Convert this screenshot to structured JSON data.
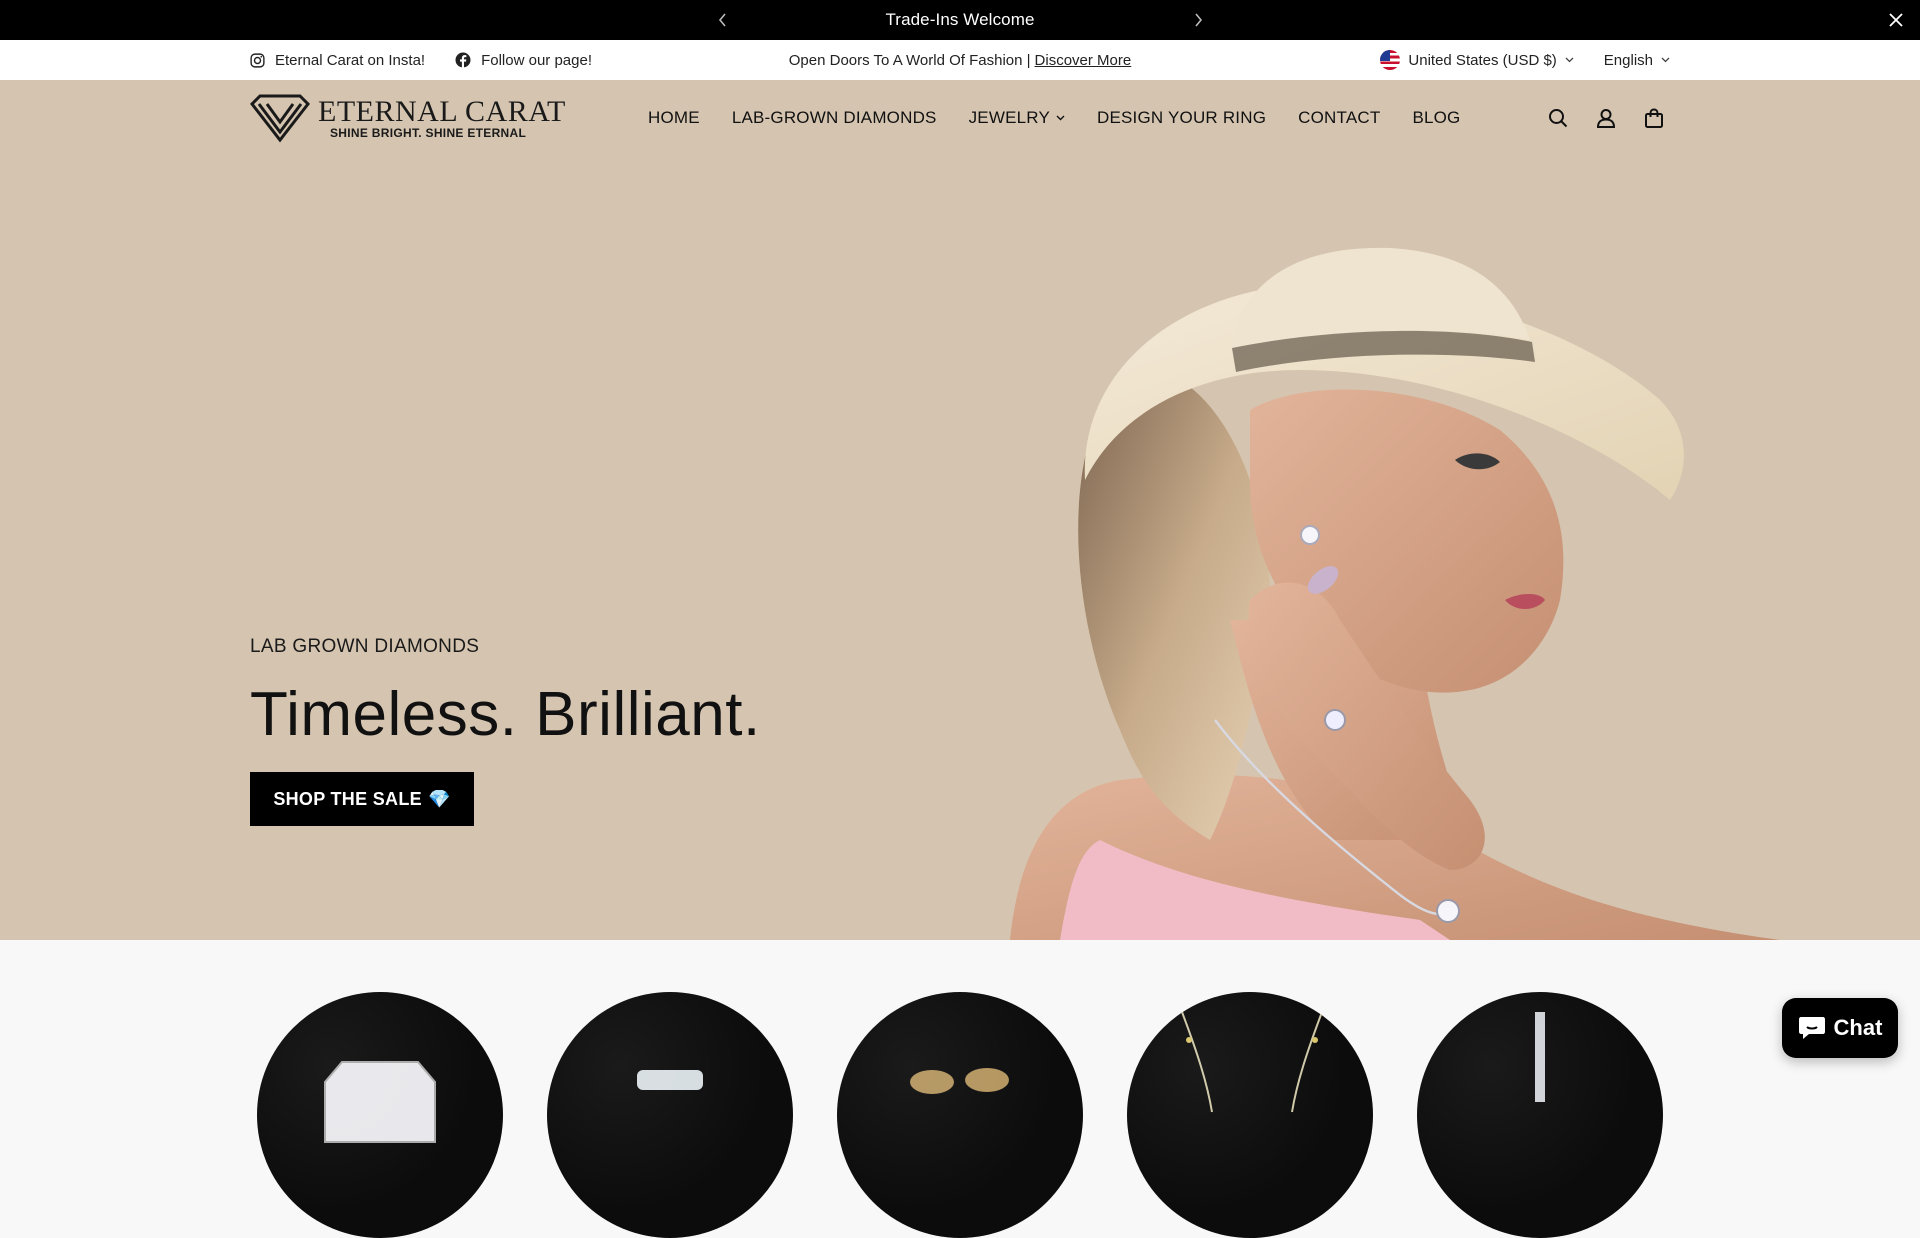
{
  "announcement": {
    "text": "Trade-Ins Welcome"
  },
  "utility": {
    "instagram_label": "Eternal Carat on Insta!",
    "facebook_label": "Follow our page!",
    "promo_text": "Open Doors To A World Of Fashion |",
    "promo_link": "Discover More",
    "country": "United States (USD $)",
    "language": "English"
  },
  "header": {
    "brand_name": "ETERNAL CARAT",
    "brand_tagline": "SHINE BRIGHT. SHINE ETERNAL",
    "nav": [
      "HOME",
      "LAB-GROWN DIAMONDS",
      "JEWELRY",
      "DESIGN YOUR RING",
      "CONTACT",
      "BLOG"
    ],
    "icons": [
      "search-icon",
      "account-icon",
      "cart-icon"
    ]
  },
  "hero": {
    "subtitle": "LAB GROWN DIAMONDS",
    "title": "Timeless. Brilliant.",
    "cta": "SHOP THE SALE",
    "cta_emoji": "💎",
    "background_color": "#d5c5b0"
  },
  "categories": [
    "diamond",
    "ring",
    "earrings",
    "necklace",
    "bracelet"
  ],
  "chat": {
    "label": "Chat"
  }
}
